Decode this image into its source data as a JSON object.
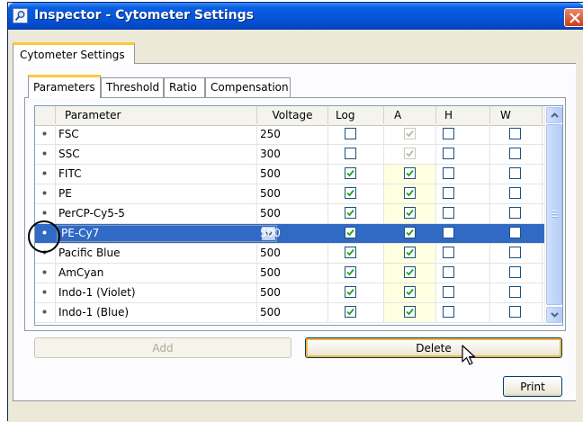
{
  "window": {
    "title": "Inspector - Cytometer Settings"
  },
  "outer_tab": {
    "label": "Cytometer Settings"
  },
  "inner_tabs": [
    {
      "label": "Parameters",
      "active": true
    },
    {
      "label": "Threshold",
      "active": false
    },
    {
      "label": "Ratio",
      "active": false
    },
    {
      "label": "Compensation",
      "active": false
    }
  ],
  "columns": {
    "parameter": "Parameter",
    "voltage": "Voltage",
    "log": "Log",
    "a": "A",
    "h": "H",
    "w": "W"
  },
  "rows": [
    {
      "parameter": "FSC",
      "voltage": "250",
      "log": false,
      "a": true,
      "a_disabled": true,
      "h": false,
      "w": false,
      "selected": false
    },
    {
      "parameter": "SSC",
      "voltage": "300",
      "log": false,
      "a": true,
      "a_disabled": true,
      "h": false,
      "w": false,
      "selected": false
    },
    {
      "parameter": "FITC",
      "voltage": "500",
      "log": true,
      "a": true,
      "a_disabled": false,
      "h": false,
      "w": false,
      "selected": false
    },
    {
      "parameter": "PE",
      "voltage": "500",
      "log": true,
      "a": true,
      "a_disabled": false,
      "h": false,
      "w": false,
      "selected": false
    },
    {
      "parameter": "PerCP-Cy5-5",
      "voltage": "500",
      "log": true,
      "a": true,
      "a_disabled": false,
      "h": false,
      "w": false,
      "selected": false
    },
    {
      "parameter": "PE-Cy7",
      "voltage": "500",
      "log": true,
      "a": true,
      "a_disabled": false,
      "h": false,
      "w": false,
      "selected": true
    },
    {
      "parameter": "Pacific Blue",
      "voltage": "500",
      "log": true,
      "a": true,
      "a_disabled": false,
      "h": false,
      "w": false,
      "selected": false
    },
    {
      "parameter": "AmCyan",
      "voltage": "500",
      "log": true,
      "a": true,
      "a_disabled": false,
      "h": false,
      "w": false,
      "selected": false
    },
    {
      "parameter": "Indo-1 (Violet)",
      "voltage": "500",
      "log": true,
      "a": true,
      "a_disabled": false,
      "h": false,
      "w": false,
      "selected": false
    },
    {
      "parameter": "Indo-1 (Blue)",
      "voltage": "500",
      "log": true,
      "a": true,
      "a_disabled": false,
      "h": false,
      "w": false,
      "selected": false
    }
  ],
  "buttons": {
    "add": "Add",
    "delete": "Delete",
    "print": "Print"
  },
  "colors": {
    "selection": "#316AC5",
    "title_bar": "#0454D8",
    "tab_highlight": "#FFC83C",
    "a_column": "#FFFFE1"
  },
  "icons": {
    "title": "magnifier-icon",
    "close": "close-icon",
    "row_marker": "bullet-icon",
    "pointer": "mouse-pointer-icon"
  }
}
